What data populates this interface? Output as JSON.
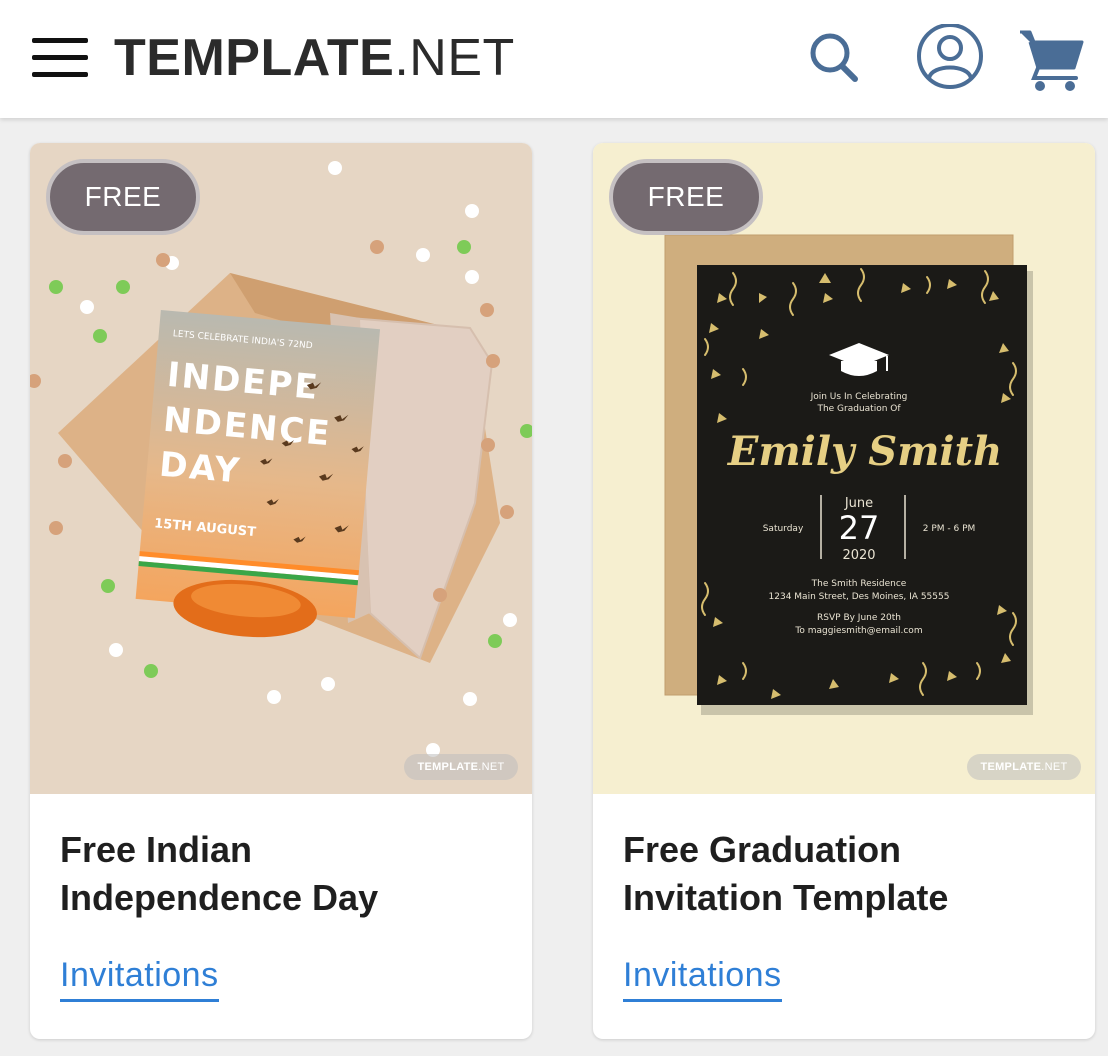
{
  "header": {
    "logo_bold": "TEMPLATE",
    "logo_light": ".NET",
    "icons": [
      "menu-icon",
      "search-icon",
      "account-icon",
      "cart-icon"
    ]
  },
  "cards": [
    {
      "badge": "FREE",
      "title_line1": "Free Indian",
      "title_line2": "Independence Day",
      "category": "Invitations",
      "watermark_bold": "TEMPLATE",
      "watermark_light": ".NET",
      "thumb": {
        "kicker": "LETS CELEBRATE INDIA'S 72ND",
        "line1": "INDEPE",
        "line2": "NDENCE",
        "line3": "DAY",
        "date": "15TH AUGUST"
      }
    },
    {
      "badge": "FREE",
      "title_line1": "Free Graduation",
      "title_line2": "Invitation Template",
      "category": "Invitations",
      "watermark_bold": "TEMPLATE",
      "watermark_light": ".NET",
      "thumb": {
        "intro1": "Join Us In Celebrating",
        "intro2": "The Graduation Of",
        "name": "Emily Smith",
        "day": "Saturday",
        "month": "June",
        "date": "27",
        "year": "2020",
        "time": "2 PM - 6 PM",
        "venue": "The Smith Residence",
        "address": "1234 Main Street, Des Moines, IA 55555",
        "rsvp": "RSVP By June 20th",
        "email": "To maggiesmith@email.com"
      }
    }
  ],
  "colors": {
    "accent": "#2f7fd6",
    "icon": "#4a6d96",
    "badge": "#746a70"
  }
}
